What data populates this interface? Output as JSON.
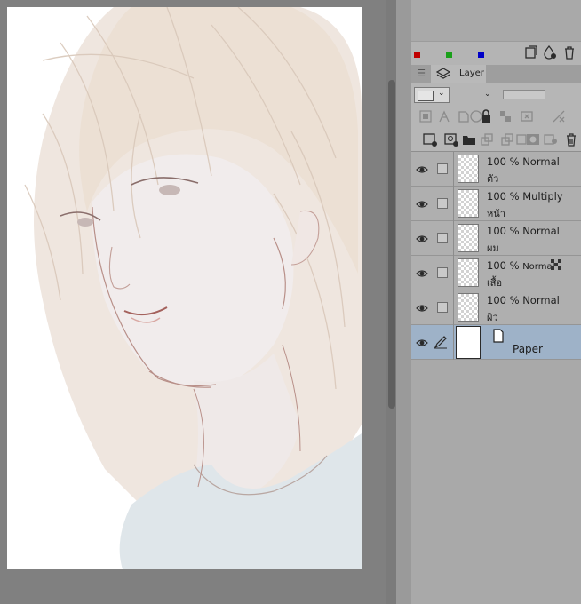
{
  "palette": {
    "red": "#c00000",
    "green": "#1aa01a",
    "blue": "#0000c8"
  },
  "panel_tab": {
    "label": "Layer",
    "icon": "layers-icon"
  },
  "layers": [
    {
      "opacity": "100 %",
      "blend": "Normal",
      "name": "ตัว"
    },
    {
      "opacity": "100 %",
      "blend": "Multiply",
      "name": "หน้า"
    },
    {
      "opacity": "100 %",
      "blend": "Normal",
      "name": "ผม"
    },
    {
      "opacity": "100 %",
      "blend": "Normal",
      "name": "เสื้อ"
    },
    {
      "opacity": "100 %",
      "blend": "Normal",
      "name": "ผิว"
    },
    {
      "name": "Paper"
    }
  ]
}
